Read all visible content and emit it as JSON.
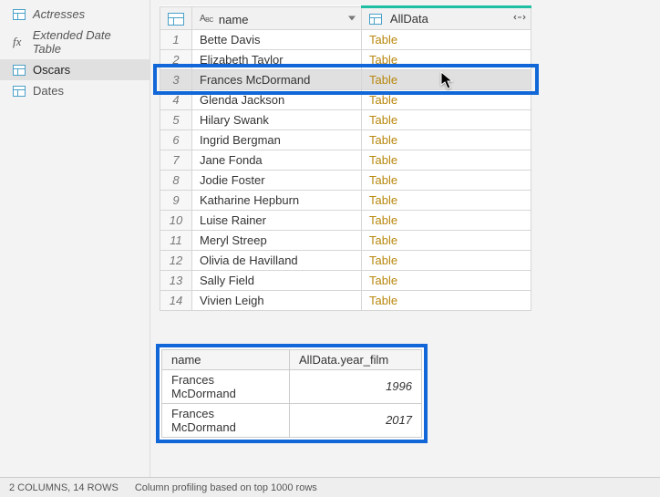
{
  "sidebar": {
    "items": [
      {
        "label": "Actresses",
        "icon": "table",
        "italic": true
      },
      {
        "label": "Extended Date Table",
        "icon": "fx",
        "italic": true
      },
      {
        "label": "Oscars",
        "icon": "table",
        "italic": false,
        "selected": true
      },
      {
        "label": "Dates",
        "icon": "table",
        "italic": false
      }
    ]
  },
  "grid": {
    "columns": {
      "name": "name",
      "alldata": "AllData"
    },
    "rows": [
      {
        "idx": 1,
        "name": "Bette Davis",
        "alldata": "Table"
      },
      {
        "idx": 2,
        "name": "Elizabeth Taylor",
        "alldata": "Table"
      },
      {
        "idx": 3,
        "name": "Frances McDormand",
        "alldata": "Table",
        "selected": true
      },
      {
        "idx": 4,
        "name": "Glenda Jackson",
        "alldata": "Table"
      },
      {
        "idx": 5,
        "name": "Hilary Swank",
        "alldata": "Table"
      },
      {
        "idx": 6,
        "name": "Ingrid Bergman",
        "alldata": "Table"
      },
      {
        "idx": 7,
        "name": "Jane Fonda",
        "alldata": "Table"
      },
      {
        "idx": 8,
        "name": "Jodie Foster",
        "alldata": "Table"
      },
      {
        "idx": 9,
        "name": "Katharine Hepburn",
        "alldata": "Table"
      },
      {
        "idx": 10,
        "name": "Luise Rainer",
        "alldata": "Table"
      },
      {
        "idx": 11,
        "name": "Meryl Streep",
        "alldata": "Table"
      },
      {
        "idx": 12,
        "name": "Olivia de Havilland",
        "alldata": "Table"
      },
      {
        "idx": 13,
        "name": "Sally Field",
        "alldata": "Table"
      },
      {
        "idx": 14,
        "name": "Vivien Leigh",
        "alldata": "Table"
      }
    ]
  },
  "preview": {
    "columns": {
      "c1": "name",
      "c2": "AllData.year_film"
    },
    "rows": [
      {
        "name": "Frances McDormand",
        "year": "1996"
      },
      {
        "name": "Frances McDormand",
        "year": "2017"
      }
    ]
  },
  "status": {
    "cols_rows": "2 COLUMNS, 14 ROWS",
    "profiling": "Column profiling based on top 1000 rows"
  }
}
